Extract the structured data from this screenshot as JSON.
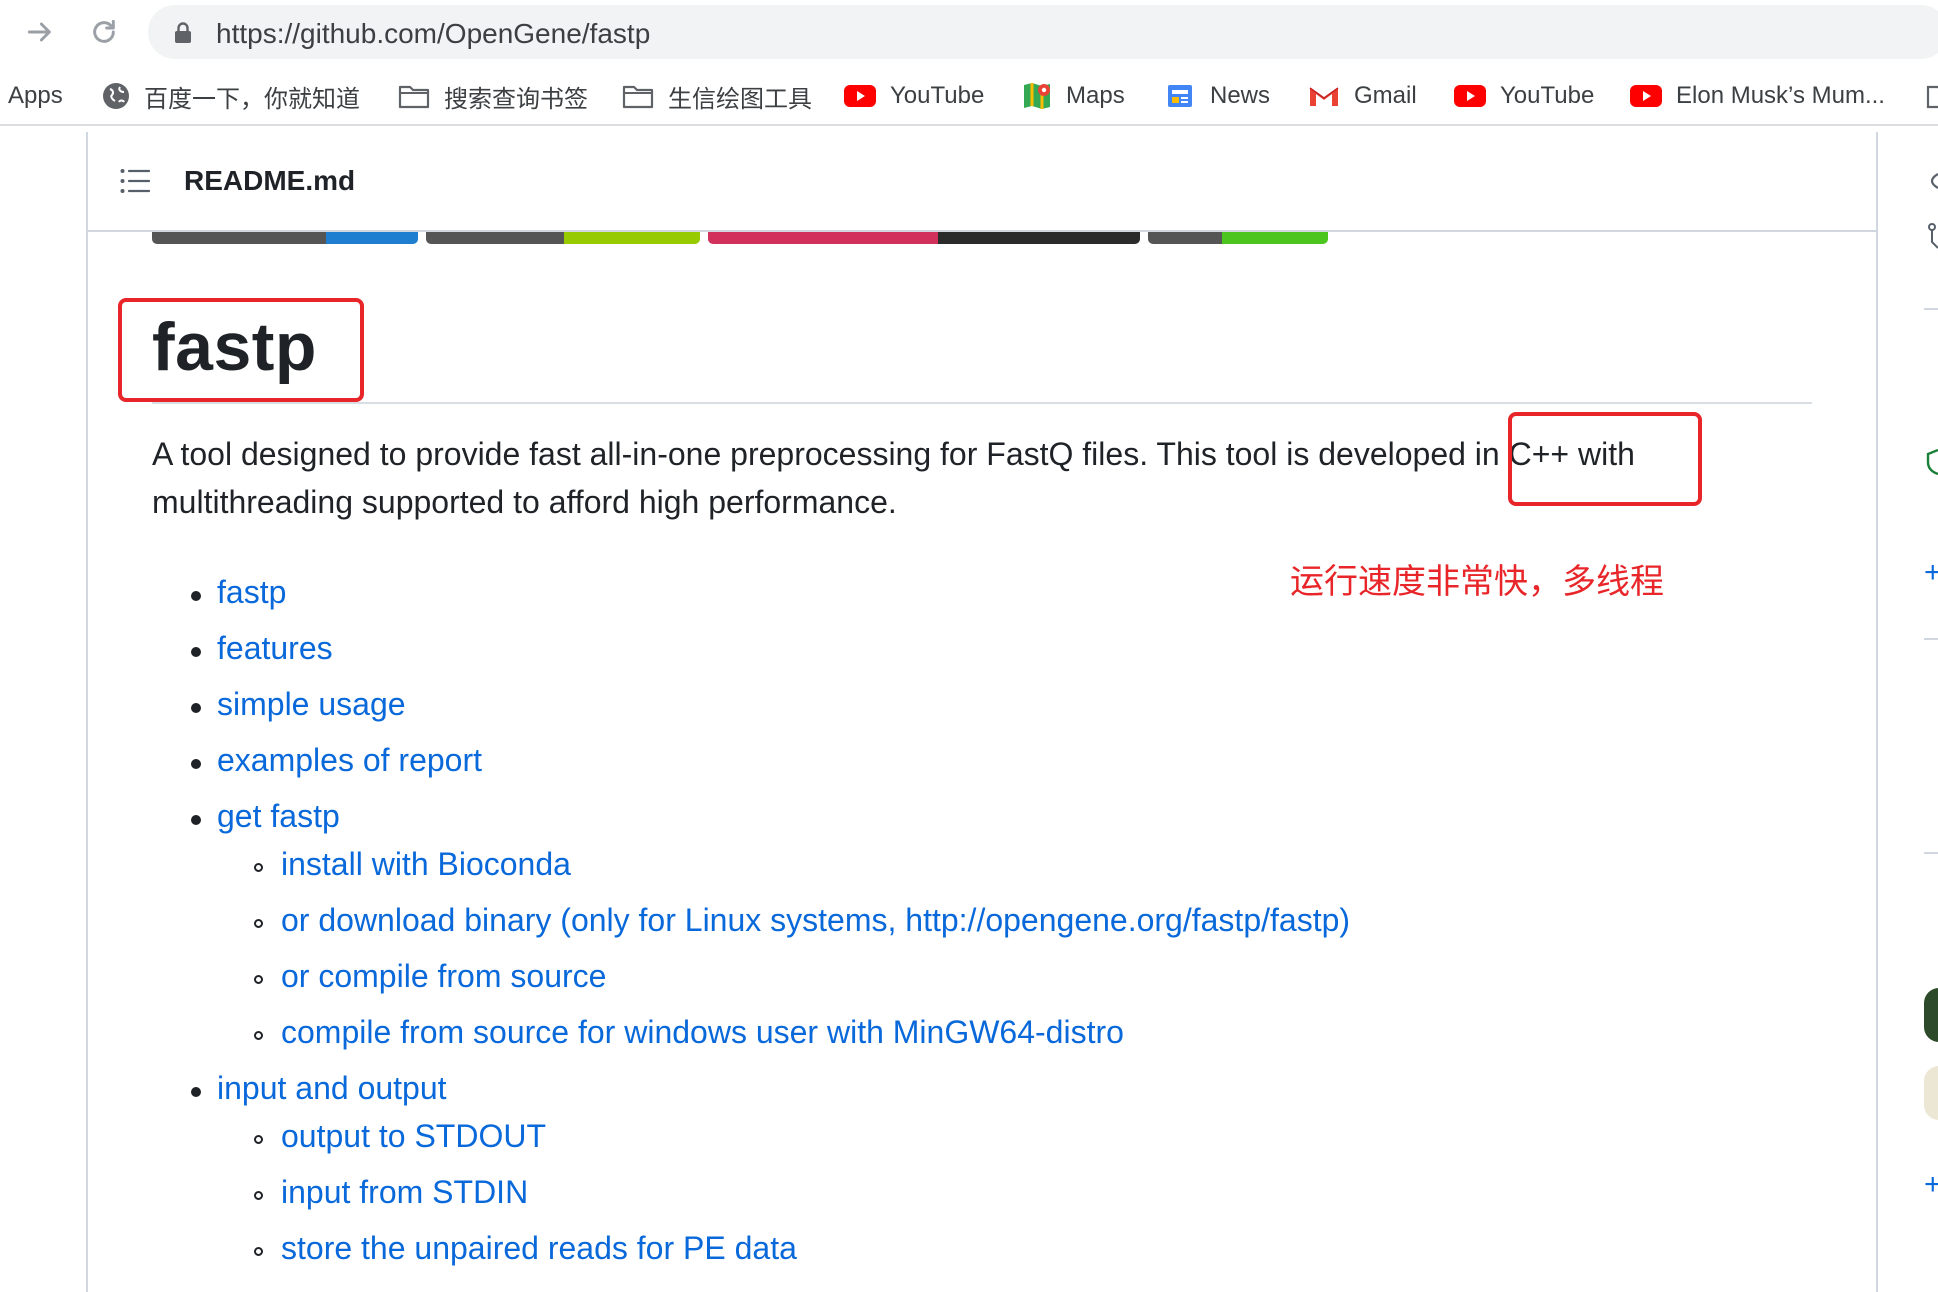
{
  "browser": {
    "url": "https://github.com/OpenGene/fastp",
    "bookmarks": [
      {
        "label": "Apps",
        "icon": "apps-grid-icon"
      },
      {
        "label": "百度一下，你就知道",
        "icon": "globe-icon"
      },
      {
        "label": "搜索查询书签",
        "icon": "folder-icon"
      },
      {
        "label": "生信绘图工具",
        "icon": "folder-icon"
      },
      {
        "label": "YouTube",
        "icon": "youtube-icon"
      },
      {
        "label": "Maps",
        "icon": "maps-icon"
      },
      {
        "label": "News",
        "icon": "news-icon"
      },
      {
        "label": "Gmail",
        "icon": "gmail-icon"
      },
      {
        "label": "YouTube",
        "icon": "youtube-icon"
      },
      {
        "label": "Elon Musk’s Mum...",
        "icon": "youtube-icon"
      }
    ]
  },
  "readme": {
    "filename": "README.md",
    "title": "fastp",
    "description_1": "A tool designed to provide fast all-in-one preprocessing for FastQ files. This tool is developed in C++ with",
    "description_2": "multithreading supported to afford high performance.",
    "toc": [
      {
        "label": "fastp",
        "level": 1
      },
      {
        "label": "features",
        "level": 1
      },
      {
        "label": "simple usage",
        "level": 1
      },
      {
        "label": "examples of report",
        "level": 1
      },
      {
        "label": "get fastp",
        "level": 1
      },
      {
        "label": "install with Bioconda",
        "level": 2
      },
      {
        "label": "or download binary (only for Linux systems, http://opengene.org/fastp/fastp)",
        "level": 2
      },
      {
        "label": "or compile from source",
        "level": 2
      },
      {
        "label": "compile from source for windows user with MinGW64-distro",
        "level": 2
      },
      {
        "label": "input and output",
        "level": 1
      },
      {
        "label": "output to STDOUT",
        "level": 2
      },
      {
        "label": "input from STDIN",
        "level": 2
      },
      {
        "label": "store the unpaired reads for PE data",
        "level": 2
      }
    ]
  },
  "annotation": {
    "note": "运行速度非常快，多线程",
    "color": "#e8262a"
  },
  "colors": {
    "link": "#0969da",
    "text": "#1f2328",
    "border": "#d0d7de"
  }
}
